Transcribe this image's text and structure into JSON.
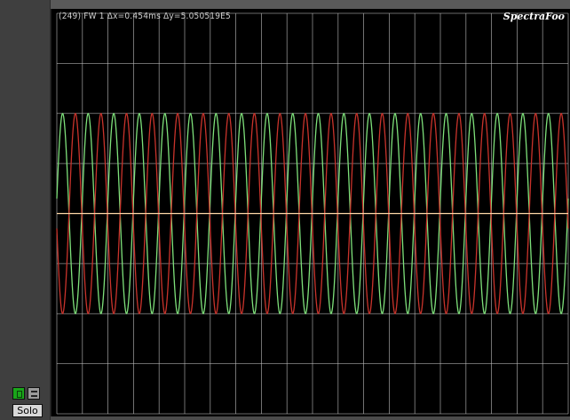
{
  "sidebar": {
    "monitor_toggle": {
      "icon": "monitor-toggle-icon",
      "state": "on",
      "color": "#1aa61a"
    },
    "list_toggle": {
      "icon": "list-icon"
    },
    "solo_label": "Solo"
  },
  "plot": {
    "header_text": "(249) FW 1  Δx=0.454ms  Δy=5.050519E5",
    "brand_text": "SpectraFoo",
    "colors": {
      "background": "#000000",
      "grid": "#bdbdbd",
      "center_line": "#ffd8a8",
      "trace_green": "#7ee07a",
      "trace_red": "#c9332b"
    },
    "grid": {
      "visible": true,
      "vertical_divisions": 20,
      "horizontal_divisions": 8
    },
    "traces": [
      {
        "name": "trace-green",
        "cycles": 20,
        "phase_deg": 0,
        "amplitude_divisions": 2
      },
      {
        "name": "trace-red",
        "cycles": 20,
        "phase_deg": 180,
        "amplitude_divisions": 2
      }
    ]
  }
}
